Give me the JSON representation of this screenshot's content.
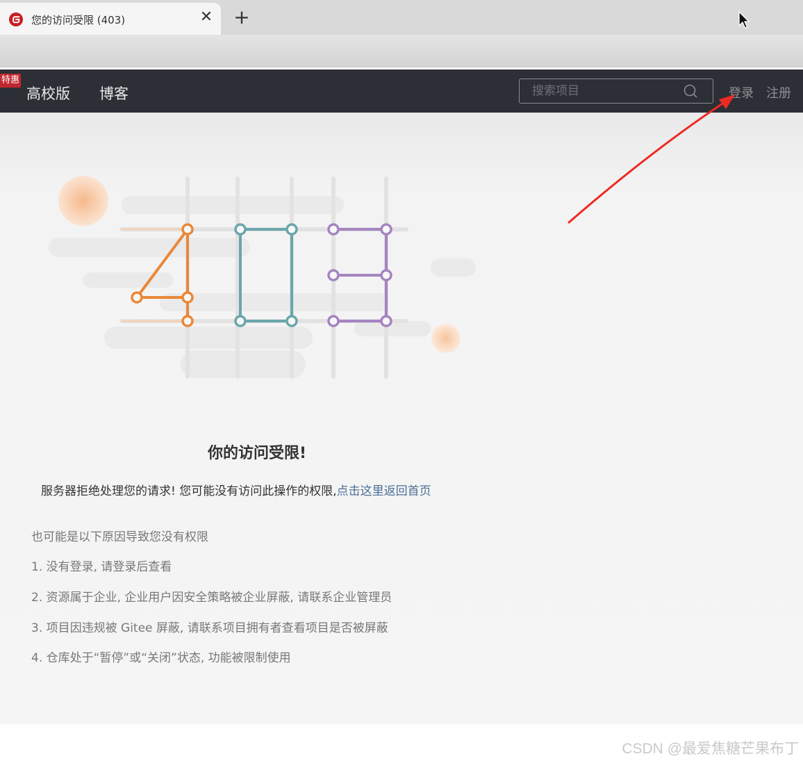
{
  "browser": {
    "tab_title": "您的访问受限 (403)",
    "close_symbol": "✕",
    "new_tab_symbol": "+"
  },
  "header": {
    "promo_badge": "特惠",
    "nav": [
      "高校版",
      "博客"
    ],
    "search_placeholder": "搜索项目",
    "login": "登录",
    "register": "注册"
  },
  "main": {
    "error_code": "403",
    "title": "你的访问受限!",
    "description": "服务器拒绝处理您的请求! 您可能没有访问此操作的权限,",
    "home_link": "点击这里返回首页",
    "reasons_heading": "也可能是以下原因导致您没有权限",
    "reasons": [
      "1. 没有登录, 请登录后查看",
      "2. 资源属于企业, 企业用户因安全策略被企业屏蔽, 请联系企业管理员",
      "3. 项目因违规被 Gitee 屏蔽, 请联系项目拥有者查看项目是否被屏蔽",
      "4. 仓库处于“暂停”或“关闭”状态, 功能被限制使用"
    ]
  },
  "watermark": "CSDN @最爱焦糖芒果布丁",
  "colors": {
    "header_bg": "#2d2f36",
    "promo_badge": "#c2262d",
    "digit_4": "#e9883a",
    "digit_0": "#6aa6ac",
    "digit_3": "#a584c0",
    "link": "#4b6e96",
    "annotation_arrow": "#ee2a24"
  }
}
